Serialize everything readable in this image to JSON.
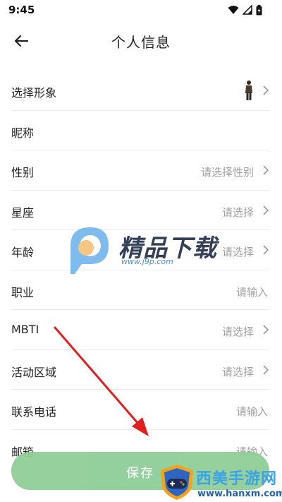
{
  "status": {
    "time": "9:45"
  },
  "header": {
    "title": "个人信息"
  },
  "rows": [
    {
      "label": "选择形象",
      "value": "",
      "arrow": true
    },
    {
      "label": "昵称",
      "value": "",
      "arrow": false
    },
    {
      "label": "性别",
      "value": "请选择性别",
      "arrow": true
    },
    {
      "label": "星座",
      "value": "请选择",
      "arrow": true
    },
    {
      "label": "年龄",
      "value": "请选择",
      "arrow": true
    },
    {
      "label": "职业",
      "value": "请输入",
      "arrow": false
    },
    {
      "label": "MBTI",
      "value": "请选择",
      "arrow": true
    },
    {
      "label": "活动区域",
      "value": "请选择",
      "arrow": true
    },
    {
      "label": "联系电话",
      "value": "请输入",
      "arrow": false
    },
    {
      "label": "邮箱",
      "value": "请输入",
      "arrow": false
    }
  ],
  "save": {
    "label": "保存"
  },
  "watermarks": {
    "center_title": "精品下载",
    "center_url": "www.j9p.com",
    "bottom_title": "西美手游网",
    "bottom_url": "www.hanxm.com"
  },
  "colors": {
    "save_button": "#8fce98",
    "annotation_arrow": "#e02020"
  }
}
